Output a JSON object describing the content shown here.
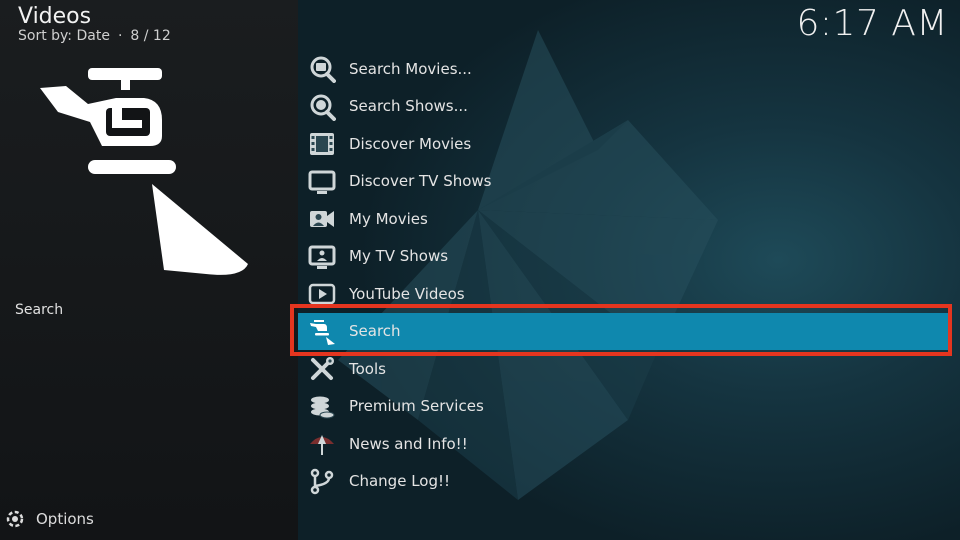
{
  "header": {
    "title": "Videos",
    "sort_label": "Sort by: Date",
    "separator": "·",
    "position": "8 / 12",
    "clock": "6:17 AM"
  },
  "left": {
    "focused_label": "Search",
    "options_label": "Options"
  },
  "menu": {
    "selected_index": 7,
    "items": [
      {
        "label": "Search Movies...",
        "icon": "search-movies-icon"
      },
      {
        "label": "Search Shows...",
        "icon": "search-shows-icon"
      },
      {
        "label": "Discover Movies",
        "icon": "film-icon"
      },
      {
        "label": "Discover TV Shows",
        "icon": "tv-icon"
      },
      {
        "label": "My Movies",
        "icon": "camera-user-icon"
      },
      {
        "label": "My TV Shows",
        "icon": "tv-user-icon"
      },
      {
        "label": "YouTube Videos",
        "icon": "youtube-icon"
      },
      {
        "label": "Search",
        "icon": "searchlight-icon"
      },
      {
        "label": "Tools",
        "icon": "tools-icon"
      },
      {
        "label": "Premium Services",
        "icon": "coins-icon"
      },
      {
        "label": "News and Info!!",
        "icon": "umbrella-icon"
      },
      {
        "label": "Change Log!!",
        "icon": "branch-icon"
      }
    ]
  },
  "colors": {
    "selection": "#0f88ae",
    "highlight_border": "#e5351f",
    "backdrop": "#153440"
  }
}
